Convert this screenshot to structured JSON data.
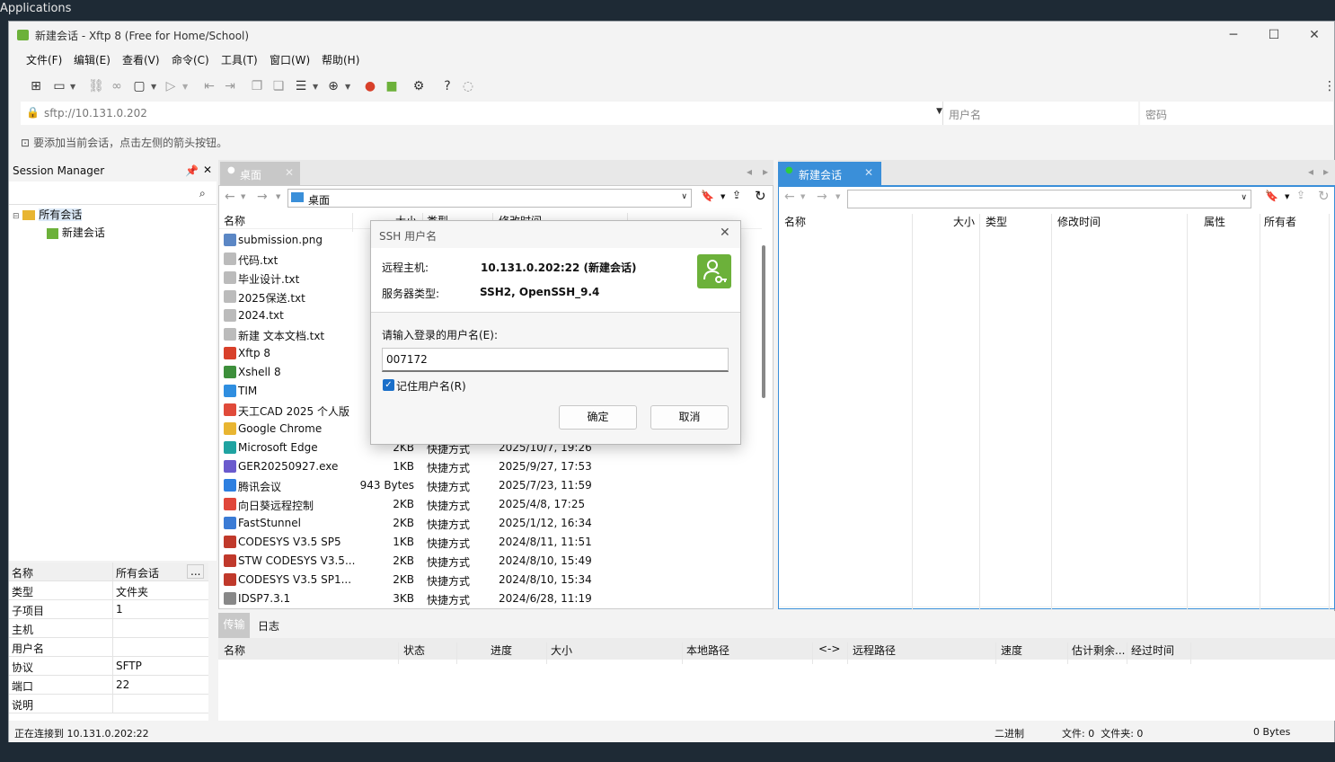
{
  "topbar": {
    "label": "Applications"
  },
  "window": {
    "title": "新建会话 - Xftp 8 (Free for Home/School)"
  },
  "menu": [
    "文件(F)",
    "编辑(E)",
    "查看(V)",
    "命令(C)",
    "工具(T)",
    "窗口(W)",
    "帮助(H)"
  ],
  "address": {
    "value": "sftp://10.131.0.202",
    "user_placeholder": "用户名",
    "pass_placeholder": "密码"
  },
  "hint": "要添加当前会话，点击左侧的箭头按钮。",
  "session_manager": {
    "title": "Session Manager",
    "tree": {
      "root": "所有会话",
      "child": "新建会话"
    }
  },
  "properties": {
    "header": {
      "key": "名称",
      "value": "所有会话"
    },
    "rows": [
      {
        "k": "类型",
        "v": "文件夹"
      },
      {
        "k": "子项目",
        "v": "1"
      },
      {
        "k": "主机",
        "v": ""
      },
      {
        "k": "用户名",
        "v": ""
      },
      {
        "k": "协议",
        "v": "SFTP"
      },
      {
        "k": "端口",
        "v": "22"
      },
      {
        "k": "说明",
        "v": ""
      }
    ]
  },
  "local": {
    "tab": "桌面",
    "path": "桌面",
    "columns": [
      "名称",
      "大小",
      "类型",
      "修改时间"
    ],
    "files": [
      {
        "name": "submission.png",
        "size": "",
        "type": "",
        "date": "",
        "color": "#5b87c5"
      },
      {
        "name": "代码.txt",
        "size": "",
        "type": "",
        "date": "",
        "color": "#bbbbbb"
      },
      {
        "name": "毕业设计.txt",
        "size": "",
        "type": "",
        "date": "",
        "color": "#bbbbbb"
      },
      {
        "name": "2025保送.txt",
        "size": "",
        "type": "",
        "date": "",
        "color": "#bbbbbb"
      },
      {
        "name": "2024.txt",
        "size": "",
        "type": "",
        "date": "",
        "color": "#bbbbbb"
      },
      {
        "name": "新建 文本文档.txt",
        "size": "",
        "type": "",
        "date": "",
        "color": "#bbbbbb"
      },
      {
        "name": "Xftp 8",
        "size": "",
        "type": "",
        "date": "",
        "color": "#d8402a"
      },
      {
        "name": "Xshell 8",
        "size": "",
        "type": "",
        "date": "",
        "color": "#3d8f3b"
      },
      {
        "name": "TIM",
        "size": "",
        "type": "",
        "date": "",
        "color": "#2f8ee0"
      },
      {
        "name": "天工CAD 2025 个人版",
        "size": "",
        "type": "",
        "date": "",
        "color": "#e04a3a"
      },
      {
        "name": "Google Chrome",
        "size": "",
        "type": "",
        "date": "",
        "color": "#e8b531"
      },
      {
        "name": "Microsoft Edge",
        "size": "2KB",
        "type": "快捷方式",
        "date": "2025/10/7, 19:26",
        "color": "#1fa3a1"
      },
      {
        "name": "GER20250927.exe",
        "size": "1KB",
        "type": "快捷方式",
        "date": "2025/9/27, 17:53",
        "color": "#6a5acd"
      },
      {
        "name": "腾讯会议",
        "size": "943 Bytes",
        "type": "快捷方式",
        "date": "2025/7/23, 11:59",
        "color": "#2d7fe0"
      },
      {
        "name": "向日葵远程控制",
        "size": "2KB",
        "type": "快捷方式",
        "date": "2025/4/8, 17:25",
        "color": "#e0463a"
      },
      {
        "name": "FastStunnel",
        "size": "2KB",
        "type": "快捷方式",
        "date": "2025/1/12, 16:34",
        "color": "#3a7bd5"
      },
      {
        "name": "CODESYS V3.5 SP5",
        "size": "1KB",
        "type": "快捷方式",
        "date": "2024/8/11, 11:51",
        "color": "#c0392b"
      },
      {
        "name": "STW CODESYS V3.5...",
        "size": "2KB",
        "type": "快捷方式",
        "date": "2024/8/10, 15:49",
        "color": "#c0392b"
      },
      {
        "name": "CODESYS V3.5 SP1...",
        "size": "2KB",
        "type": "快捷方式",
        "date": "2024/8/10, 15:34",
        "color": "#c0392b"
      },
      {
        "name": "IDSP7.3.1",
        "size": "3KB",
        "type": "快捷方式",
        "date": "2024/6/28, 11:19",
        "color": "#888888"
      }
    ]
  },
  "remote": {
    "tab": "新建会话",
    "columns": [
      "名称",
      "大小",
      "类型",
      "修改时间",
      "属性",
      "所有者"
    ]
  },
  "transfer": {
    "tabs": [
      "传输",
      "日志"
    ],
    "columns": [
      "名称",
      "状态",
      "进度",
      "大小",
      "本地路径",
      "<->",
      "远程路径",
      "速度",
      "估计剩余...",
      "经过时间"
    ]
  },
  "status": {
    "left": "正在连接到 10.131.0.202:22",
    "mode": "二进制",
    "counts": "文件: 0  文件夹: 0",
    "bytes": "0 Bytes"
  },
  "dialog": {
    "title": "SSH 用户名",
    "host_label": "远程主机:",
    "host_value": "10.131.0.202:22 (新建会话)",
    "server_label": "服务器类型:",
    "server_value": "SSH2, OpenSSH_9.4",
    "prompt": "请输入登录的用户名(E):",
    "username": "007172",
    "remember": "记住用户名(R)",
    "ok": "确定",
    "cancel": "取消"
  },
  "colors": {
    "accent": "#3a8fd9",
    "tab_active": "#3a8fd9",
    "green": "#6cb13a"
  }
}
